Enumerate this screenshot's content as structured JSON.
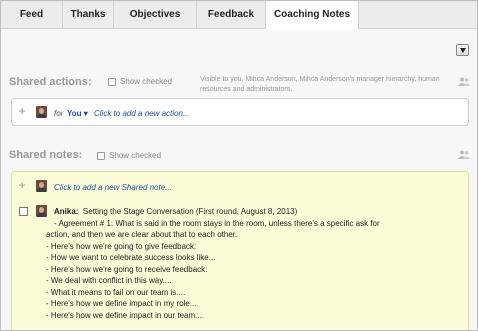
{
  "tabs": [
    {
      "label": "Feed"
    },
    {
      "label": "Thanks"
    },
    {
      "label": "Objectives"
    },
    {
      "label": "Feedback"
    },
    {
      "label": "Coaching Notes"
    }
  ],
  "shared_actions": {
    "title": "Shared actions:",
    "show_checked_label": "Show checked",
    "visibility_line1": "Visible to you, Mihca Anderson, Mihca Anderson's manager hierarchy, human",
    "visibility_line2": "resources and administrators.",
    "for_label": "for",
    "for_value": "You",
    "for_caret": "▾",
    "add_action_link": "Click to add a new action..."
  },
  "shared_notes": {
    "title": "Shared notes:",
    "show_checked_label": "Show checked",
    "add_note_link": "Click to add a new Shared note...",
    "note": {
      "author": "Anika:",
      "line0": "Setting the Stage Conversation (First round, August 8, 2013)",
      "lines": [
        "- Agreement # 1: What is said in the room stays in the room, unless there's a specific ask for",
        "action, and then we are clear about that to each other.",
        "- Here's how we're going to give feedback:",
        "- How we want to celebrate success looks like...",
        "- Here's how we're going to receive feedback:",
        "- We deal with conflict in this way....",
        "- What it means to fail on our team is....",
        "- Here's how we define impact in my role...",
        "- Here's how we define impact in our team...."
      ]
    }
  },
  "colors": {
    "link": "#1a4f9c",
    "note_background": "#fdfcd9",
    "section_title": "#999999"
  },
  "icons": {
    "plus": "+",
    "dropdown": "triangle-down-icon",
    "people": "people-icon"
  }
}
